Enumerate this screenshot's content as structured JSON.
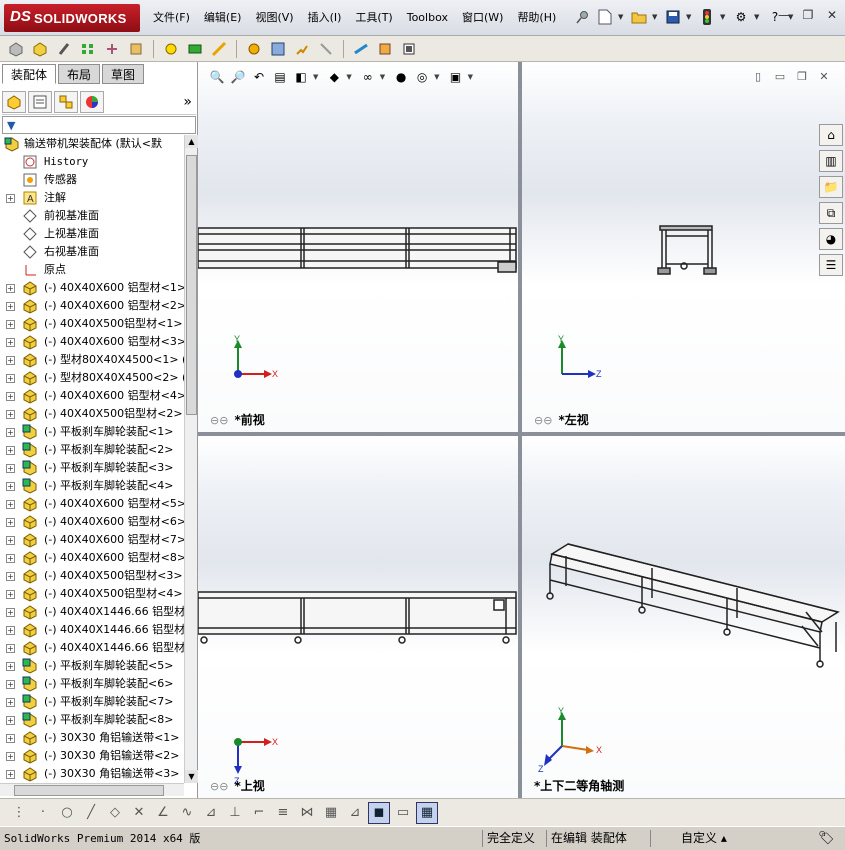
{
  "app": {
    "logo_ds": "DS",
    "logo_name": "SOLIDWORKS",
    "menu": [
      "文件(F)",
      "编辑(E)",
      "视图(V)",
      "插入(I)",
      "工具(T)",
      "Toolbox",
      "窗口(W)",
      "帮助(H)"
    ],
    "quick_help": "?"
  },
  "panel": {
    "tabs": [
      "装配体",
      "布局",
      "草图"
    ],
    "active_tab": "装配体",
    "expand_chevron": "»"
  },
  "tree": {
    "root": "输送带机架装配体  (默认<默",
    "items": [
      {
        "label": "History",
        "mono": true,
        "icon": "history-icon",
        "expand": false
      },
      {
        "label": "传感器",
        "icon": "sensor-icon",
        "expand": false
      },
      {
        "label": "注解",
        "icon": "annotation-icon",
        "expand": true
      },
      {
        "label": "前视基准面",
        "icon": "plane-icon",
        "expand": false
      },
      {
        "label": "上视基准面",
        "icon": "plane-icon",
        "expand": false
      },
      {
        "label": "右视基准面",
        "icon": "plane-icon",
        "expand": false
      },
      {
        "label": "原点",
        "icon": "origin-icon",
        "expand": false
      },
      {
        "label": "(-) 40X40X600 铝型材<1>",
        "icon": "part-icon",
        "expand": true
      },
      {
        "label": "(-) 40X40X600 铝型材<2>",
        "icon": "part-icon",
        "expand": true
      },
      {
        "label": "(-) 40X40X500铝型材<1>",
        "icon": "part-icon",
        "expand": true
      },
      {
        "label": "(-) 40X40X600 铝型材<3>",
        "icon": "part-icon",
        "expand": true
      },
      {
        "label": "(-) 型材80X40X4500<1> (",
        "icon": "part-icon",
        "expand": true
      },
      {
        "label": "(-) 型材80X40X4500<2> (",
        "icon": "part-icon",
        "expand": true
      },
      {
        "label": "(-) 40X40X600 铝型材<4>",
        "icon": "part-icon",
        "expand": true
      },
      {
        "label": "(-) 40X40X500铝型材<2>",
        "icon": "part-icon",
        "expand": true
      },
      {
        "label": "(-) 平板刹车脚轮装配<1>",
        "icon": "subassembly-icon",
        "expand": true
      },
      {
        "label": "(-) 平板刹车脚轮装配<2>",
        "icon": "subassembly-icon",
        "expand": true
      },
      {
        "label": "(-) 平板刹车脚轮装配<3>",
        "icon": "subassembly-icon",
        "expand": true
      },
      {
        "label": "(-) 平板刹车脚轮装配<4>",
        "icon": "subassembly-icon",
        "expand": true
      },
      {
        "label": "(-) 40X40X600 铝型材<5>",
        "icon": "part-icon",
        "expand": true
      },
      {
        "label": "(-) 40X40X600 铝型材<6>",
        "icon": "part-icon",
        "expand": true
      },
      {
        "label": "(-) 40X40X600 铝型材<7>",
        "icon": "part-icon",
        "expand": true
      },
      {
        "label": "(-) 40X40X600 铝型材<8>",
        "icon": "part-icon",
        "expand": true
      },
      {
        "label": "(-) 40X40X500铝型材<3>",
        "icon": "part-icon",
        "expand": true
      },
      {
        "label": "(-) 40X40X500铝型材<4>",
        "icon": "part-icon",
        "expand": true
      },
      {
        "label": "(-) 40X40X1446.66 铝型材",
        "icon": "part-icon",
        "expand": true
      },
      {
        "label": "(-) 40X40X1446.66 铝型材",
        "icon": "part-icon",
        "expand": true
      },
      {
        "label": "(-) 40X40X1446.66 铝型材",
        "icon": "part-icon",
        "expand": true
      },
      {
        "label": "(-) 平板刹车脚轮装配<5>",
        "icon": "subassembly-icon",
        "expand": true
      },
      {
        "label": "(-) 平板刹车脚轮装配<6>",
        "icon": "subassembly-icon",
        "expand": true
      },
      {
        "label": "(-) 平板刹车脚轮装配<7>",
        "icon": "subassembly-icon",
        "expand": true
      },
      {
        "label": "(-) 平板刹车脚轮装配<8>",
        "icon": "subassembly-icon",
        "expand": true
      },
      {
        "label": "(-) 30X30 角铝输送带<1>",
        "icon": "part-icon",
        "expand": true
      },
      {
        "label": "(-) 30X30 角铝输送带<2>",
        "icon": "part-icon",
        "expand": true
      },
      {
        "label": "(-) 30X30 角铝输送带<3>",
        "icon": "part-icon",
        "expand": true
      }
    ]
  },
  "viewports": {
    "front": {
      "name": "*前视",
      "axis_y": "Y",
      "axis_x": "X"
    },
    "left": {
      "name": "*左视",
      "axis_y": "Y",
      "axis_x": "Z"
    },
    "top": {
      "name": "*上视",
      "axis_x": "X",
      "axis_z": "Z"
    },
    "iso": {
      "name": "*上下二等角轴测",
      "axis_y": "Y",
      "axis_x": "X",
      "axis_z": "Z"
    }
  },
  "status": {
    "product": "SolidWorks Premium 2014 x64 版",
    "definition": "完全定义",
    "editing": "在编辑 装配体",
    "units": "自定义",
    "units_arrow": "▴"
  },
  "colors": {
    "brand": "#b5121b",
    "axis_y": "#1a8a2a",
    "axis_x": "#d02020",
    "axis_z": "#2030c0",
    "frame": "#222222"
  }
}
